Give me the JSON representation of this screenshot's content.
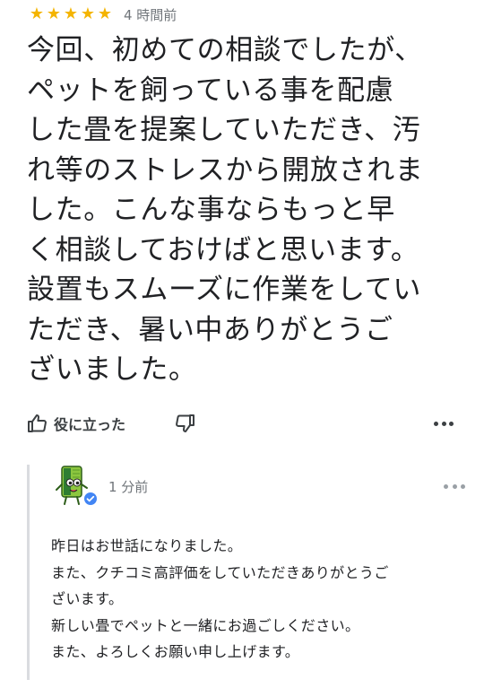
{
  "review": {
    "rating": 5,
    "rating_max": 5,
    "stars": [
      "★",
      "★",
      "★",
      "★",
      "★"
    ],
    "timestamp": "4 時間前",
    "text": "今回、初めての相談でしたが、\nペットを飼っている事を配慮\nした畳を提案していただき、汚\nれ等のストレスから開放されま\nした。こんな事ならもっと早\nく相談しておけばと思います。\n設置もスムーズに作業をしてい\nただき、暑い中ありがとうご\nざいました。",
    "helpful_label": "役に立った",
    "icons": {
      "helpful": "thumbs-up-icon",
      "dislike": "thumbs-down-icon",
      "more": "more-horizontal-icon"
    }
  },
  "owner_reply": {
    "timestamp": "1 分前",
    "text": "昨日はお世話になりました。\nまた、クチコミ高評価をしていただきありがとうご\nざいます。\n新しい畳でペットと一緒にお過ごしください。\nまた、よろしくお願い申し上げます。",
    "icons": {
      "avatar": "tatami-mascot-avatar",
      "badge": "verified-badge-icon",
      "more": "more-horizontal-icon"
    }
  },
  "colors": {
    "star": "#f4b400",
    "secondary_text": "#70757a",
    "primary_text": "#202124",
    "verified_badge": "#4285f4",
    "divider": "#dadce0"
  }
}
